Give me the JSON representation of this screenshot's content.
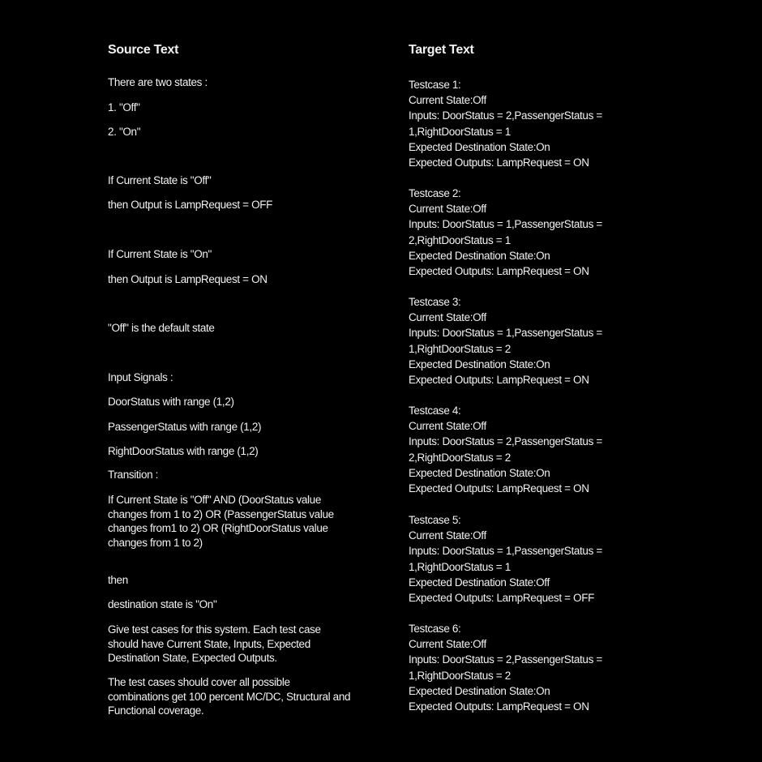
{
  "source": {
    "heading": "Source Text",
    "lines": [
      "There are two states :",
      "1. \"Off\"",
      "2. \"On\"",
      "If Current State is \"Off\"",
      "then Output is LampRequest  = OFF",
      "If Current State is \"On\"",
      "then Output is LampRequest  = ON",
      "\"Off\" is the default state",
      "Input Signals :",
      "DoorStatus  with range (1,2)",
      "PassengerStatus with range (1,2)",
      "RightDoorStatus with range (1,2)",
      "Transition :"
    ],
    "transition_rule": "If Current State is \"Off\"  AND (DoorStatus value changes from 1 to 2) OR (PassengerStatus value changes from1 to 2) OR (RightDoorStatus value changes from 1 to 2)",
    "then": "then",
    "destination": "destination state is \"On\"",
    "instruction": "Give test cases for this system. Each test case should have Current State, Inputs, Expected Destination State, Expected Outputs.",
    "coverage": "The test cases should cover all possible combinations get 100 percent MC/DC, Structural and Functional coverage."
  },
  "target": {
    "heading": "Target Text",
    "testcases": [
      {
        "title": "Testcase 1:",
        "current_state": "Current State:Off",
        "inputs_1": "Inputs: DoorStatus = 2,PassengerStatus =",
        "inputs_2": "1,RightDoorStatus = 1",
        "dest_state": "Expected Destination State:On",
        "outputs": "Expected Outputs: LampRequest  = ON"
      },
      {
        "title": "Testcase 2:",
        "current_state": "Current State:Off",
        "inputs_1": "Inputs: DoorStatus = 1,PassengerStatus =",
        "inputs_2": "2,RightDoorStatus = 1",
        "dest_state": "Expected Destination State:On",
        "outputs": "Expected Outputs: LampRequest  = ON"
      },
      {
        "title": "Testcase 3:",
        "current_state": "Current State:Off",
        "inputs_1": "Inputs: DoorStatus = 1,PassengerStatus =",
        "inputs_2": "1,RightDoorStatus = 2",
        "dest_state": "Expected Destination State:On",
        "outputs": "Expected Outputs: LampRequest  = ON"
      },
      {
        "title": "Testcase 4:",
        "current_state": "Current State:Off",
        "inputs_1": "Inputs: DoorStatus = 2,PassengerStatus =",
        "inputs_2": "2,RightDoorStatus = 2",
        "dest_state": "Expected Destination State:On",
        "outputs": "Expected Outputs: LampRequest  = ON"
      },
      {
        "title": "Testcase 5:",
        "current_state": "Current State:Off",
        "inputs_1": "Inputs: DoorStatus = 1,PassengerStatus =",
        "inputs_2": "1,RightDoorStatus = 1",
        "dest_state": "Expected Destination State:Off",
        "outputs": "Expected Outputs: LampRequest  = OFF"
      },
      {
        "title": "Testcase 6:",
        "current_state": "Current State:Off",
        "inputs_1": "Inputs: DoorStatus = 2,PassengerStatus =",
        "inputs_2": "1,RightDoorStatus = 2",
        "dest_state": "Expected Destination State:On",
        "outputs": "Expected Outputs: LampRequest  = ON"
      }
    ]
  }
}
